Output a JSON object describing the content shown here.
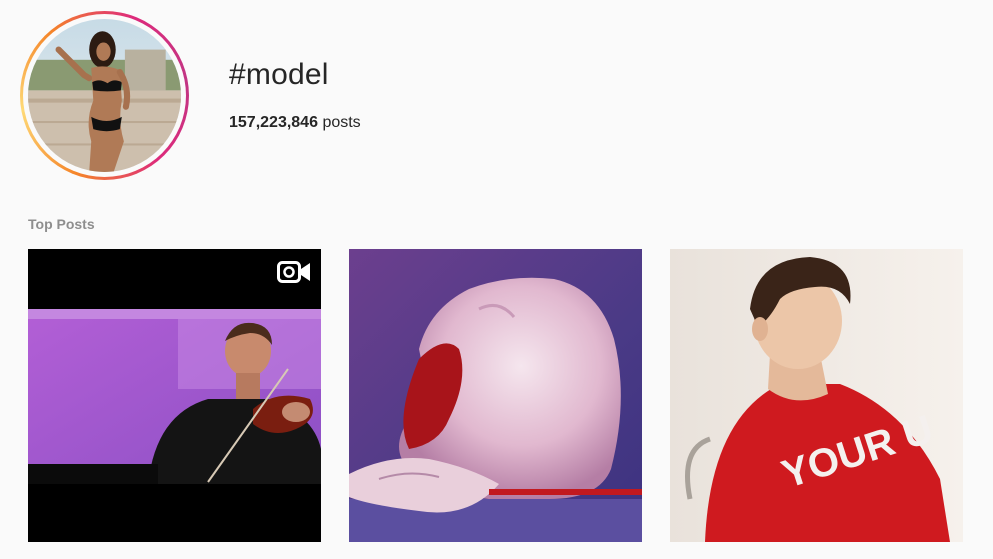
{
  "header": {
    "hashtag": "#model",
    "post_count": "157,223,846",
    "post_count_suffix": "posts"
  },
  "sections": {
    "top_posts_label": "Top Posts"
  },
  "icons": {
    "video_badge": "video-camera-icon"
  },
  "colors": {
    "text_primary": "#262626",
    "text_secondary": "#8e8e8e",
    "background": "#fafafa",
    "ring_gradient": [
      "#f58529",
      "#feda77",
      "#dd2a7b",
      "#c13584"
    ]
  }
}
